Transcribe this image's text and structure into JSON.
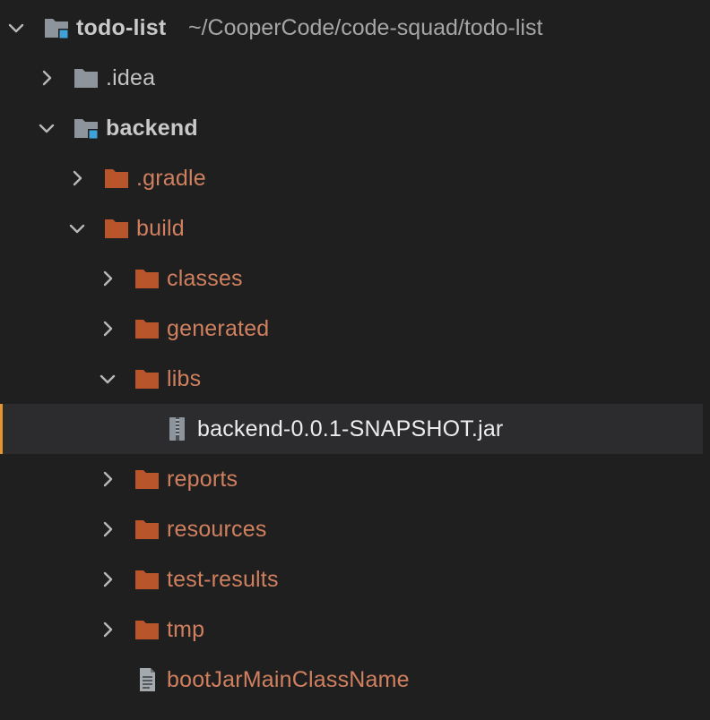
{
  "project_tree": {
    "root": {
      "name": "todo-list",
      "path": "~/CooperCode/code-squad/todo-list",
      "icon": "module-folder-icon",
      "expanded": true
    },
    "items": [
      {
        "label": ".idea",
        "icon": "folder-icon",
        "color": "#8d949b",
        "expanded": false
      },
      {
        "label": "backend",
        "icon": "module-folder-icon",
        "expanded": true
      },
      {
        "label": ".gradle",
        "icon": "folder-icon",
        "color": "#b8552b",
        "expanded": false
      },
      {
        "label": "build",
        "icon": "folder-icon",
        "color": "#b8552b",
        "expanded": true
      },
      {
        "label": "classes",
        "icon": "folder-icon",
        "color": "#b8552b",
        "expanded": false
      },
      {
        "label": "generated",
        "icon": "folder-icon",
        "color": "#b8552b",
        "expanded": false
      },
      {
        "label": "libs",
        "icon": "folder-icon",
        "color": "#b8552b",
        "expanded": true
      },
      {
        "label": "backend-0.0.1-SNAPSHOT.jar",
        "icon": "jar-archive-icon",
        "selected": true
      },
      {
        "label": "reports",
        "icon": "folder-icon",
        "color": "#b8552b",
        "expanded": false
      },
      {
        "label": "resources",
        "icon": "folder-icon",
        "color": "#b8552b",
        "expanded": false
      },
      {
        "label": "test-results",
        "icon": "folder-icon",
        "color": "#b8552b",
        "expanded": false
      },
      {
        "label": "tmp",
        "icon": "folder-icon",
        "color": "#b8552b",
        "expanded": false
      },
      {
        "label": "bootJarMainClassName",
        "icon": "text-file-icon"
      }
    ]
  },
  "colors": {
    "background": "#1f1f1f",
    "selection_bg": "#2c2c2e",
    "selection_accent": "#e5952f",
    "excluded_folder": "#b8552b",
    "excluded_text": "#d0805f",
    "module_marker": "#3ea2d8"
  }
}
